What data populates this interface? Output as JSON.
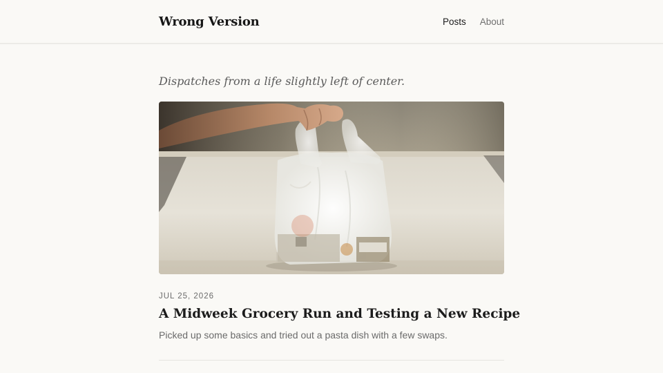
{
  "header": {
    "site_title": "Wrong Version",
    "nav": [
      {
        "label": "Posts",
        "active": true
      },
      {
        "label": "About",
        "active": false
      }
    ]
  },
  "tagline": "Dispatches from a life slightly left of center.",
  "posts": [
    {
      "date": "JUL 25, 2026",
      "title": "A Midweek Grocery Run and Testing a New Recipe",
      "excerpt": "Picked up some basics and tried out a pasta dish with a few swaps."
    }
  ],
  "colors": {
    "background": "#faf9f6",
    "title_text": "#1c1c1c",
    "muted_text": "#6a6a6a",
    "divider": "#e6e4df"
  }
}
